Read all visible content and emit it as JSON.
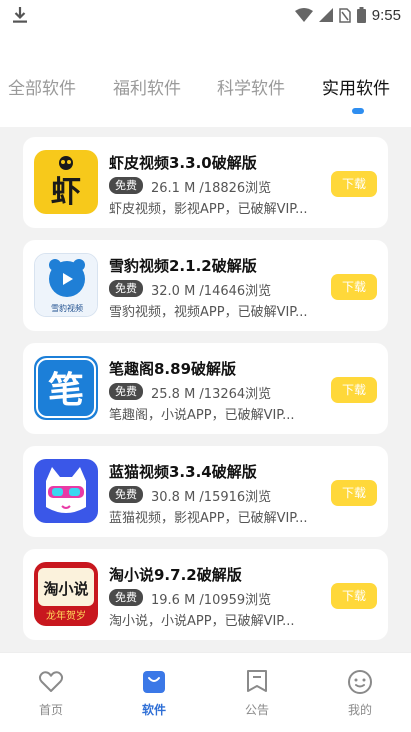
{
  "status_bar": {
    "time": "9:55"
  },
  "tabs": [
    {
      "label": "全部软件",
      "active": false
    },
    {
      "label": "福利软件",
      "active": false
    },
    {
      "label": "科学软件",
      "active": false
    },
    {
      "label": "实用软件",
      "active": true
    }
  ],
  "apps": [
    {
      "title": "虾皮视频3.3.0破解版",
      "badge": "免费",
      "meta": "26.1 M /18826浏览",
      "desc": "虾皮视频，影视APP，已破解VIP...",
      "button": "下载",
      "icon_text": "虾"
    },
    {
      "title": "雪豹视频2.1.2破解版",
      "badge": "免费",
      "meta": "32.0 M /14646浏览",
      "desc": "雪豹视频，视频APP，已破解VIP...",
      "button": "下载",
      "icon_text": "雪豹视频"
    },
    {
      "title": "笔趣阁8.89破解版",
      "badge": "免费",
      "meta": "25.8 M /13264浏览",
      "desc": "笔趣阁，小说APP，已破解VIP...",
      "button": "下载",
      "icon_text": "笔"
    },
    {
      "title": "蓝猫视频3.3.4破解版",
      "badge": "免费",
      "meta": "30.8 M /15916浏览",
      "desc": "蓝猫视频，影视APP，已破解VIP...",
      "button": "下载",
      "icon_text": ""
    },
    {
      "title": "淘小说9.7.2破解版",
      "badge": "免费",
      "meta": "19.6 M /10959浏览",
      "desc": "淘小说，小说APP，已破解VIP...",
      "button": "下载",
      "icon_text": "淘小说",
      "icon_subtext": "龙年贺岁"
    }
  ],
  "bottom_nav": [
    {
      "label": "首页",
      "icon": "heart-icon",
      "active": false
    },
    {
      "label": "软件",
      "icon": "bag-icon",
      "active": true
    },
    {
      "label": "公告",
      "icon": "bookmark-icon",
      "active": false
    },
    {
      "label": "我的",
      "icon": "smile-icon",
      "active": false
    }
  ],
  "colors": {
    "accent": "#2f6fd6",
    "download": "#ffd83a",
    "badge": "#4a4a4a"
  }
}
